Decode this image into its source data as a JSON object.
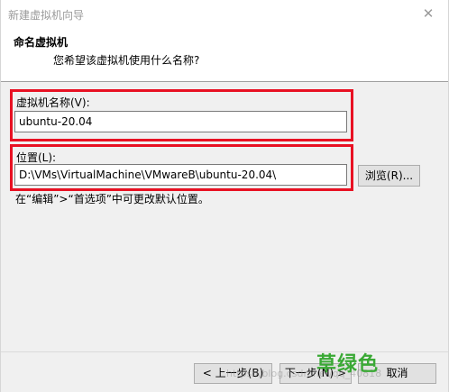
{
  "window": {
    "title": "新建虚拟机向导",
    "close_glyph": "✕"
  },
  "header": {
    "title": "命名虚拟机",
    "subtitle": "您希望该虚拟机使用什么名称?"
  },
  "name_field": {
    "label": "虚拟机名称(V):",
    "value": "ubuntu-20.04"
  },
  "location_field": {
    "label": "位置(L):",
    "value": "D:\\VMs\\VirtualMachine\\VMwareB\\ubuntu-20.04\\",
    "browse_label": "浏览(R)..."
  },
  "hint": "在“编辑”>“首选项”中可更改默认位置。",
  "footer": {
    "back_label": "< 上一步(B)",
    "next_label": "下一步(N) >",
    "cancel_label": "取消"
  },
  "watermark": {
    "text": "草绿色",
    "url": "https://blog.csdn.net/qq_40818"
  },
  "colors": {
    "highlight_border": "#e81123",
    "watermark_green": "#3aa935"
  }
}
